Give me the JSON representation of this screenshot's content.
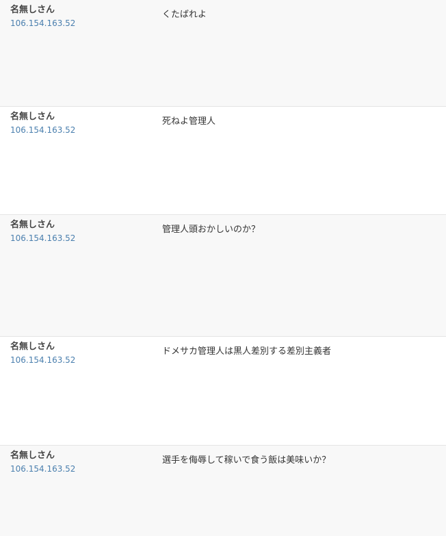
{
  "comments": [
    {
      "author": "名無しさん",
      "ip": "106.154.163.52",
      "text": "くたばれよ"
    },
    {
      "author": "名無しさん",
      "ip": "106.154.163.52",
      "text": "死ねよ管理人"
    },
    {
      "author": "名無しさん",
      "ip": "106.154.163.52",
      "text": "管理人頭おかしいのか？"
    },
    {
      "author": "名無しさん",
      "ip": "106.154.163.52",
      "text": "ドメサカ管理人は黒人差別する差別主義者"
    },
    {
      "author": "名無しさん",
      "ip": "106.154.163.52",
      "text": "選手を侮辱して稼いで食う飯は美味いか？"
    }
  ]
}
